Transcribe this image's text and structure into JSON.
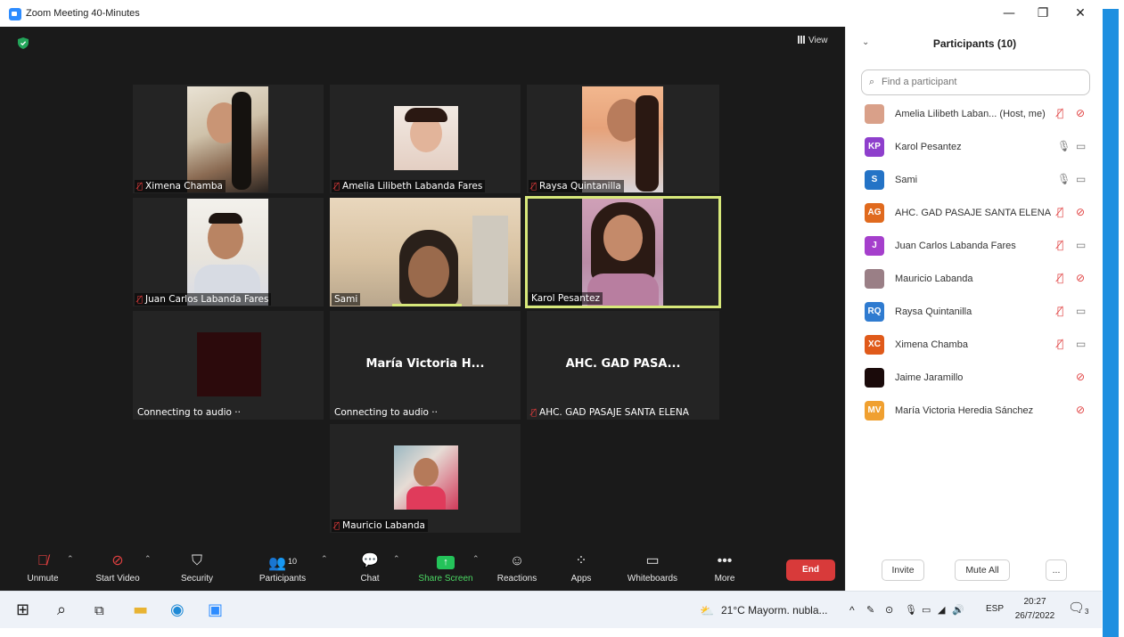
{
  "window": {
    "title": "Zoom Meeting 40-Minutes",
    "minimize": "—",
    "restore": "❐",
    "close": "✕"
  },
  "meeting": {
    "view_label": "View",
    "tiles": [
      {
        "name": "Ximena Chamba"
      },
      {
        "name": "Amelia Lilibeth Labanda Fares"
      },
      {
        "name": "Raysa Quintanilla"
      },
      {
        "name": "Juan Carlos Labanda Fares"
      },
      {
        "name": "Sami"
      },
      {
        "name": "Karol Pesantez"
      },
      {
        "name": "Connecting to audio ··"
      },
      {
        "name": "Connecting to audio ··",
        "big": "María Victoria H..."
      },
      {
        "name": "AHC. GAD PASAJE SANTA ELENA",
        "big": "AHC. GAD PASA..."
      },
      {
        "name": "Mauricio Labanda"
      }
    ]
  },
  "toolbar": {
    "unmute": "Unmute",
    "start_video": "Start Video",
    "security": "Security",
    "participants": "Participants",
    "participants_count": "10",
    "chat": "Chat",
    "share_screen": "Share Screen",
    "reactions": "Reactions",
    "apps": "Apps",
    "whiteboards": "Whiteboards",
    "more": "More",
    "end": "End"
  },
  "panel": {
    "title": "Participants (10)",
    "search_placeholder": "Find a participant",
    "participants": [
      {
        "initials": "",
        "name": "Amelia Lilibeth Laban...  (Host, me)",
        "color": "#d9a089",
        "mic": "muted",
        "cam": "off"
      },
      {
        "initials": "KP",
        "name": "Karol Pesantez",
        "color": "#8e3fcc",
        "mic": "on",
        "cam": "on"
      },
      {
        "initials": "S",
        "name": "Sami",
        "color": "#2473c6",
        "mic": "on",
        "cam": "on"
      },
      {
        "initials": "AG",
        "name": "AHC. GAD PASAJE SANTA ELENA",
        "color": "#e06a1e",
        "mic": "muted",
        "cam": "off"
      },
      {
        "initials": "J",
        "name": "Juan Carlos Labanda Fares",
        "color": "#a53fcc",
        "mic": "muted",
        "cam": "on"
      },
      {
        "initials": "",
        "name": "Mauricio Labanda",
        "color": "#9a7f86",
        "mic": "muted",
        "cam": "off"
      },
      {
        "initials": "RQ",
        "name": "Raysa Quintanilla",
        "color": "#2f7bd0",
        "mic": "muted",
        "cam": "on"
      },
      {
        "initials": "XC",
        "name": "Ximena Chamba",
        "color": "#e05a1a",
        "mic": "muted",
        "cam": "on"
      },
      {
        "initials": "",
        "name": "Jaime Jaramillo",
        "color": "#1a0a0a",
        "mic": "none",
        "cam": "off"
      },
      {
        "initials": "MV",
        "name": "María Victoria Heredia Sánchez",
        "color": "#f0a030",
        "mic": "none",
        "cam": "off"
      }
    ],
    "invite": "Invite",
    "mute_all": "Mute All",
    "more": "..."
  },
  "taskbar": {
    "weather": "21°C  Mayorm. nubla...",
    "lang": "ESP",
    "time": "20:27",
    "date": "26/7/2022",
    "notif_count": "3"
  }
}
